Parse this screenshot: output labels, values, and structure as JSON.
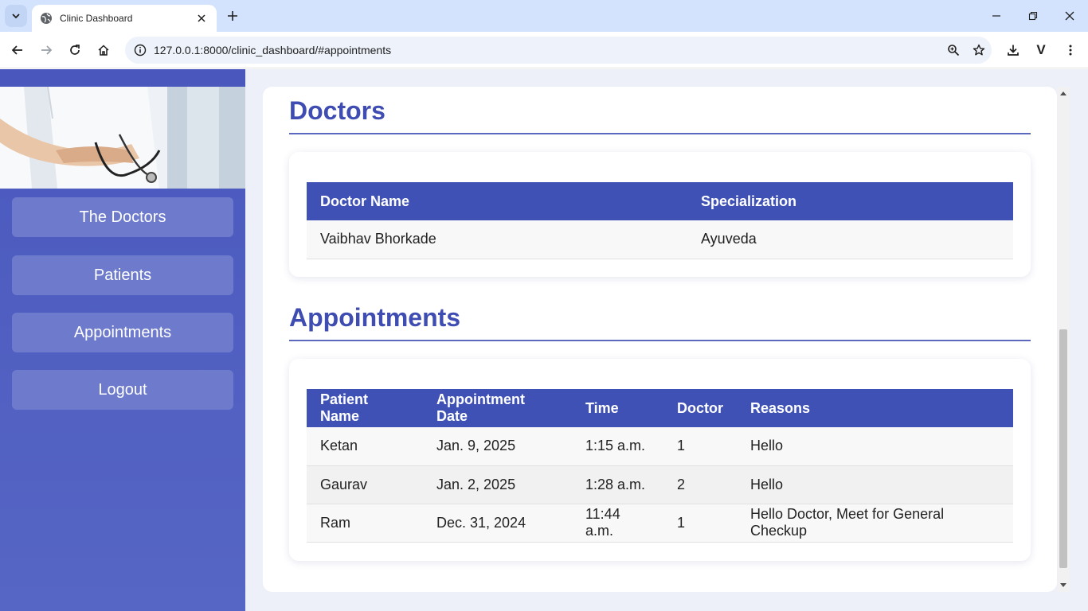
{
  "browser": {
    "tab_title": "Clinic Dashboard",
    "url": "127.0.0.1:8000/clinic_dashboard/#appointments",
    "profile_initial": "V"
  },
  "sidebar": {
    "items": [
      {
        "label": "The Doctors"
      },
      {
        "label": "Patients"
      },
      {
        "label": "Appointments"
      },
      {
        "label": "Logout"
      }
    ]
  },
  "doctors": {
    "title": "Doctors",
    "headers": [
      "Doctor Name",
      "Specialization"
    ],
    "rows": [
      [
        "Vaibhav Bhorkade",
        "Ayuveda"
      ]
    ]
  },
  "appointments": {
    "title": "Appointments",
    "headers": [
      "Patient Name",
      "Appointment Date",
      "Time",
      "Doctor",
      "Reasons"
    ],
    "rows": [
      [
        "Ketan",
        "Jan. 9, 2025",
        "1:15 a.m.",
        "1",
        "Hello"
      ],
      [
        "Gaurav",
        "Jan. 2, 2025",
        "1:28 a.m.",
        "2",
        "Hello"
      ],
      [
        "Ram",
        "Dec. 31, 2024",
        "11:44 a.m.",
        "1",
        "Hello Doctor, Meet for General Checkup"
      ]
    ]
  },
  "colors": {
    "sidebar": "#4a58be",
    "accent": "#3f4db2",
    "table_header": "#3f51b5",
    "sidebar_button": "#6e7bcc"
  }
}
